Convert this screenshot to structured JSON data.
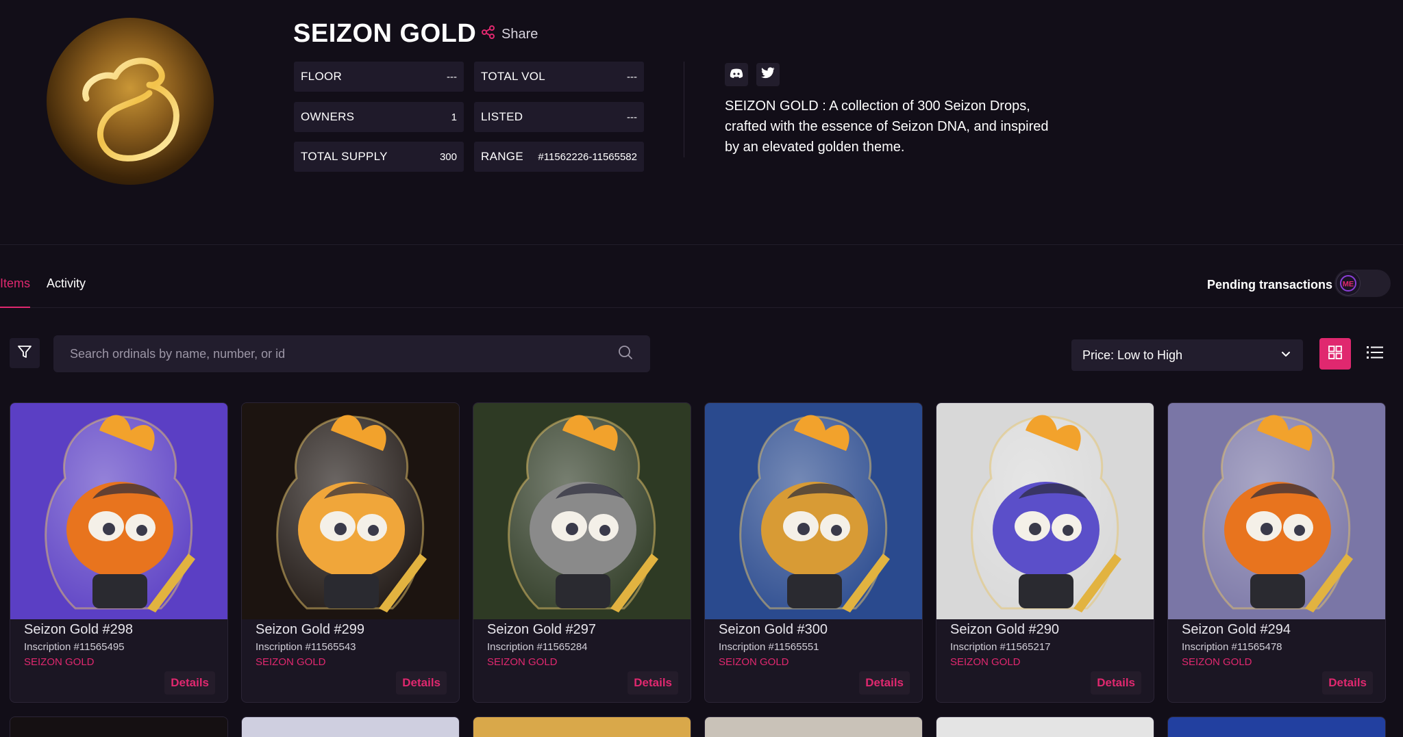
{
  "collection": {
    "title": "SEIZON GOLD",
    "share_label": "Share",
    "description": "SEIZON GOLD : A collection of 300 Seizon Drops, crafted with the essence of Seizon DNA, and inspired by an elevated golden theme.",
    "stats": [
      {
        "label": "FLOOR",
        "value": "---"
      },
      {
        "label": "TOTAL VOL",
        "value": "---"
      },
      {
        "label": "OWNERS",
        "value": "1"
      },
      {
        "label": "LISTED",
        "value": "---"
      },
      {
        "label": "TOTAL SUPPLY",
        "value": "300"
      },
      {
        "label": "RANGE",
        "value": "#11562226-11565582"
      }
    ],
    "social": [
      "discord-icon",
      "twitter-icon"
    ]
  },
  "tabs": {
    "items": "Items",
    "activity": "Activity",
    "active": "Items"
  },
  "pending": {
    "label": "Pending transactions",
    "toggle_badge": "ME"
  },
  "search": {
    "placeholder": "Search ordinals by name, number, or id"
  },
  "sort": {
    "selected": "Price: Low to High"
  },
  "colors": {
    "accent": "#e0286f",
    "background": "#120e18",
    "panel": "#1f1a2a"
  },
  "cards": [
    {
      "name": "Seizon Gold #298",
      "inscription": "Inscription #11565495",
      "collection": "SEIZON GOLD",
      "details": "Details",
      "bg": "#5b3fc4"
    },
    {
      "name": "Seizon Gold #299",
      "inscription": "Inscription #11565543",
      "collection": "SEIZON GOLD",
      "details": "Details",
      "bg": "#1c1410"
    },
    {
      "name": "Seizon Gold #297",
      "inscription": "Inscription #11565284",
      "collection": "SEIZON GOLD",
      "details": "Details",
      "bg": "#2e3a24"
    },
    {
      "name": "Seizon Gold #300",
      "inscription": "Inscription #11565551",
      "collection": "SEIZON GOLD",
      "details": "Details",
      "bg": "#2a4a8e"
    },
    {
      "name": "Seizon Gold #290",
      "inscription": "Inscription #11565217",
      "collection": "SEIZON GOLD",
      "details": "Details",
      "bg": "#d8d8d8"
    },
    {
      "name": "Seizon Gold #294",
      "inscription": "Inscription #11565478",
      "collection": "SEIZON GOLD",
      "details": "Details",
      "bg": "#7a76a6"
    }
  ]
}
